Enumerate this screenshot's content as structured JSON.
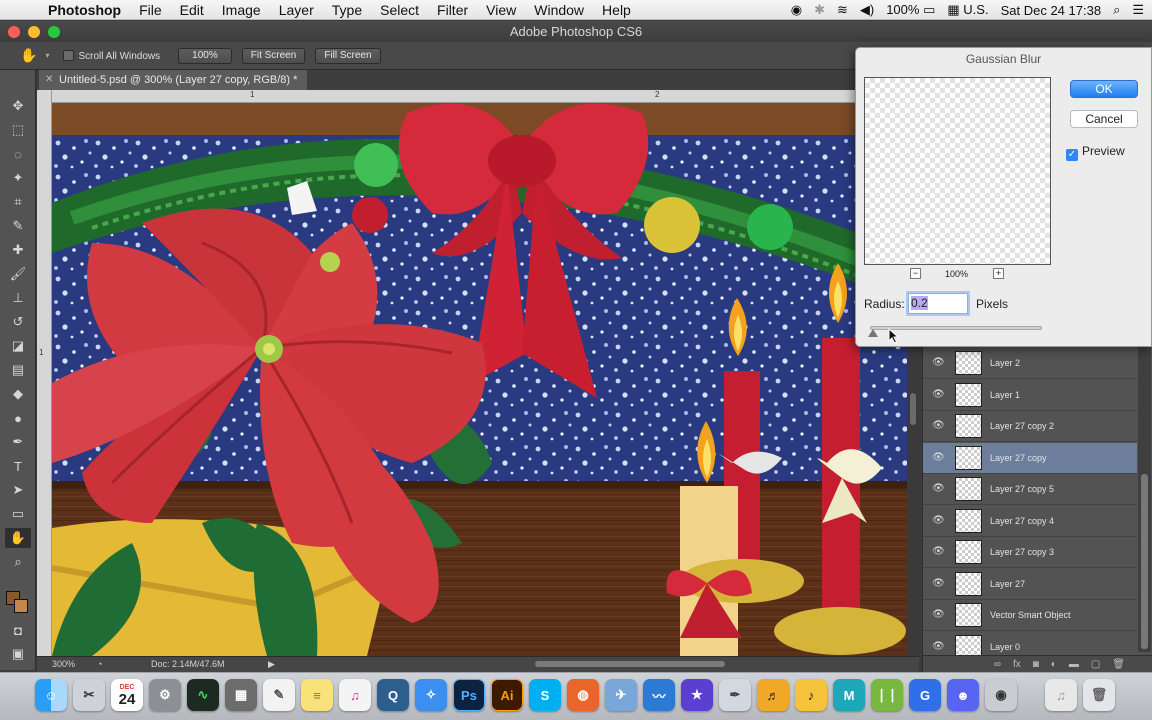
{
  "menubar": {
    "app": "Photoshop",
    "items": [
      "File",
      "Edit",
      "Image",
      "Layer",
      "Type",
      "Select",
      "Filter",
      "View",
      "Window",
      "Help"
    ],
    "battery": "100%",
    "input_source": "U.S.",
    "clock": "Sat Dec 24  17:38"
  },
  "window_title": "Adobe Photoshop CS6",
  "options_bar": {
    "scroll_all_windows": "Scroll All Windows",
    "zoom_100": "100%",
    "fit_screen": "Fit Screen",
    "fill_screen": "Fill Screen"
  },
  "document": {
    "tab_title": "Untitled-5.psd @ 300% (Layer 27 copy, RGB/8) *",
    "ruler_marks": [
      "1",
      "2"
    ],
    "ruler_v_mark": "1",
    "zoom": "300%",
    "doc_info": "Doc: 2.14M/47.6M"
  },
  "dialog": {
    "title": "Gaussian Blur",
    "ok": "OK",
    "cancel": "Cancel",
    "preview_label": "Preview",
    "preview_checked": true,
    "preview_zoom": "100%",
    "radius_label": "Radius:",
    "radius_value": "0.2",
    "radius_unit": "Pixels"
  },
  "layers": [
    {
      "name": "Layer 2",
      "selected": false
    },
    {
      "name": "Layer 1",
      "selected": false
    },
    {
      "name": "Layer 27 copy 2",
      "selected": false
    },
    {
      "name": "Layer 27 copy",
      "selected": true
    },
    {
      "name": "Layer 27 copy 5",
      "selected": false
    },
    {
      "name": "Layer 27 copy 4",
      "selected": false
    },
    {
      "name": "Layer 27 copy 3",
      "selected": false
    },
    {
      "name": "Layer 27",
      "selected": false
    },
    {
      "name": "Vector Smart Object",
      "selected": false
    },
    {
      "name": "Layer 0",
      "selected": false
    }
  ],
  "dock": {
    "calendar_month": "DEC",
    "calendar_day": "24",
    "photoshop": "Ps",
    "illustrator": "Ai"
  },
  "colors": {
    "accent": "#1f7ff0",
    "foreground_swatch": "#8a5a2b",
    "background_swatch": "#c28650",
    "selected_layer": "#6c7e9b"
  }
}
